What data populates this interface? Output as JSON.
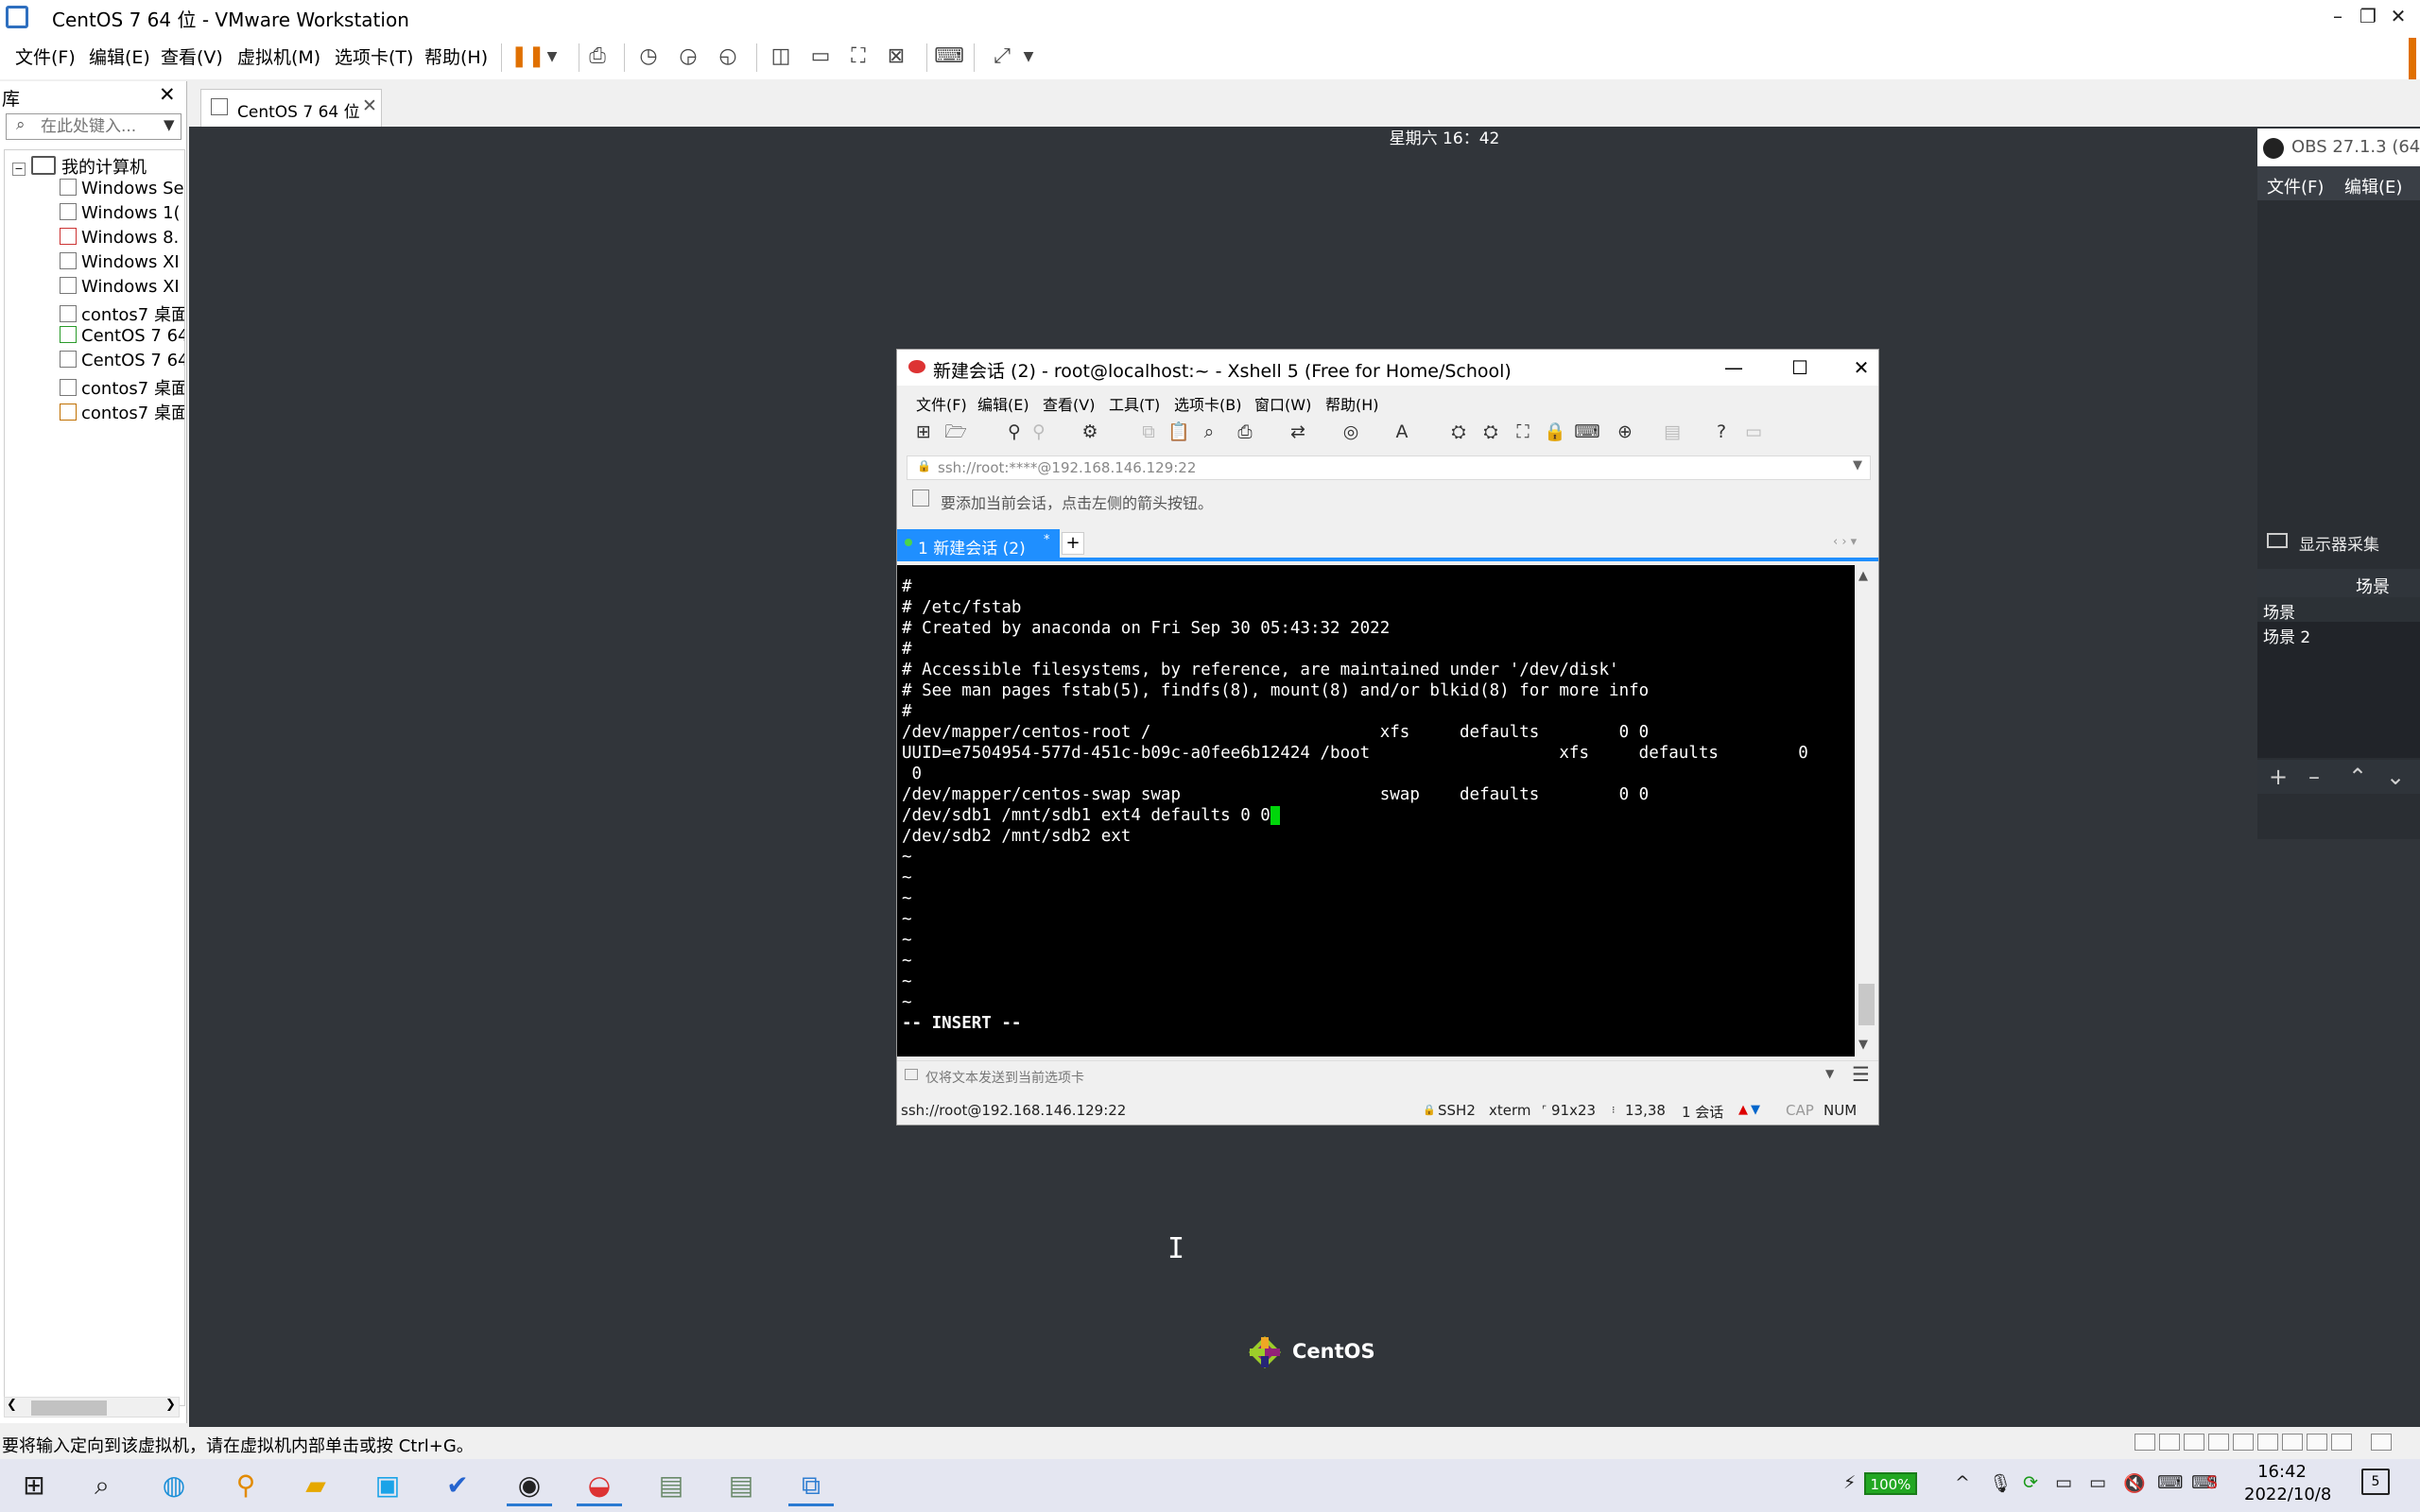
{
  "vmware": {
    "title": "CentOS 7 64 位 - VMware Workstation",
    "window_controls": [
      "–",
      "❐",
      "✕"
    ],
    "menu": [
      "文件(F)",
      "编辑(E)",
      "查看(V)",
      "虚拟机(M)",
      "选项卡(T)",
      "帮助(H)"
    ],
    "toolbar_icons": [
      "pause-icon",
      "send-ctrl-alt-del-icon",
      "snapshot-icon",
      "revert-snapshot-icon",
      "snapshot-manager-icon",
      "show-library-icon",
      "thumbnail-bar-icon",
      "full-screen-icon",
      "unity-icon",
      "console-view-icon",
      "stretch-icon"
    ]
  },
  "library": {
    "title": "库",
    "close": "✕",
    "search_placeholder": "在此处键入...",
    "root": "我的计算机",
    "items": [
      {
        "label": "Windows Se",
        "state": "off"
      },
      {
        "label": "Windows 1(",
        "state": "off"
      },
      {
        "label": "Windows 8.",
        "state": "error"
      },
      {
        "label": "Windows XI",
        "state": "off"
      },
      {
        "label": "Windows XI",
        "state": "off"
      },
      {
        "label": "contos7 桌面",
        "state": "off"
      },
      {
        "label": "CentOS 7 64",
        "state": "running"
      },
      {
        "label": "CentOS 7 64",
        "state": "off"
      },
      {
        "label": "contos7 桌面",
        "state": "off"
      },
      {
        "label": "contos7 桌面",
        "state": "suspended"
      }
    ]
  },
  "vm_tab": {
    "label": "CentOS 7 64 位",
    "close": "✕"
  },
  "guest": {
    "clock": "星期六 16：42",
    "centos_label": "CentOS"
  },
  "xshell": {
    "title": "新建会话 (2) - root@localhost:~ - Xshell 5 (Free for Home/School)",
    "window_controls": [
      "—",
      "☐",
      "✕"
    ],
    "menu": [
      "文件(F)",
      "编辑(E)",
      "查看(V)",
      "工具(T)",
      "选项卡(B)",
      "窗口(W)",
      "帮助(H)"
    ],
    "address": "ssh://root:****@192.168.146.129:22",
    "hint": "要添加当前会话，点击左侧的箭头按钮。",
    "tab_label": "1 新建会话 (2)",
    "tab_add": "+",
    "terminal": {
      "lines": [
        "#",
        "# /etc/fstab",
        "# Created by anaconda on Fri Sep 30 05:43:32 2022",
        "#",
        "# Accessible filesystems, by reference, are maintained under '/dev/disk'",
        "# See man pages fstab(5), findfs(8), mount(8) and/or blkid(8) for more info",
        "#",
        "/dev/mapper/centos-root /                       xfs     defaults        0 0",
        "UUID=e7504954-577d-451c-b09c-a0fee6b12424 /boot                   xfs     defaults        0",
        " 0",
        "/dev/mapper/centos-swap swap                    swap    defaults        0 0"
      ],
      "cursor_line_before": "/dev/sdb1 /mnt/sdb1 ext4 defaults 0 0",
      "cursor_char": " ",
      "after_lines": [
        "/dev/sdb2 /mnt/sdb2 ext",
        "~",
        "~",
        "~",
        "~",
        "~",
        "~",
        "~",
        "~"
      ],
      "mode": "-- INSERT --"
    },
    "compose_placeholder": "仅将文本发送到当前选项卡",
    "status": {
      "connection": "ssh://root@192.168.146.129:22",
      "protocol": "SSH2",
      "terminal_type": "xterm",
      "size": "91x23",
      "cursor_pos": "13,38",
      "sessions": "1 会话",
      "cap": "CAP",
      "num": "NUM"
    }
  },
  "obs": {
    "title": "OBS 27.1.3 (64-",
    "menu": [
      "文件(F)",
      "编辑(E)"
    ],
    "source_label": "显示器采集",
    "scenes_header": "场景",
    "scenes": [
      "场景",
      "场景 2"
    ],
    "scene_buttons": [
      "+",
      "–",
      "⌃",
      "⌄"
    ]
  },
  "statusbar": {
    "text": "要将输入定向到该虚拟机，请在虚拟机内部单击或按 Ctrl+G。"
  },
  "taskbar": {
    "apps": [
      "windows-start-icon",
      "search-icon",
      "edge-icon",
      "search-tool-icon",
      "file-explorer-icon",
      "bilibili-icon",
      "todo-icon",
      "obs-icon",
      "xshell-icon",
      "wps-icon",
      "wps-icon-2",
      "vmware-icon"
    ],
    "battery": "100%",
    "time": "16:42",
    "date": "2022/10/8",
    "notifications": "5"
  },
  "colors": {
    "guest_background": "#31353a",
    "xshell_tab_blue": "#1f8fff",
    "terminal_cursor": "#00d60a",
    "obs_dark": "#2a2e33"
  }
}
